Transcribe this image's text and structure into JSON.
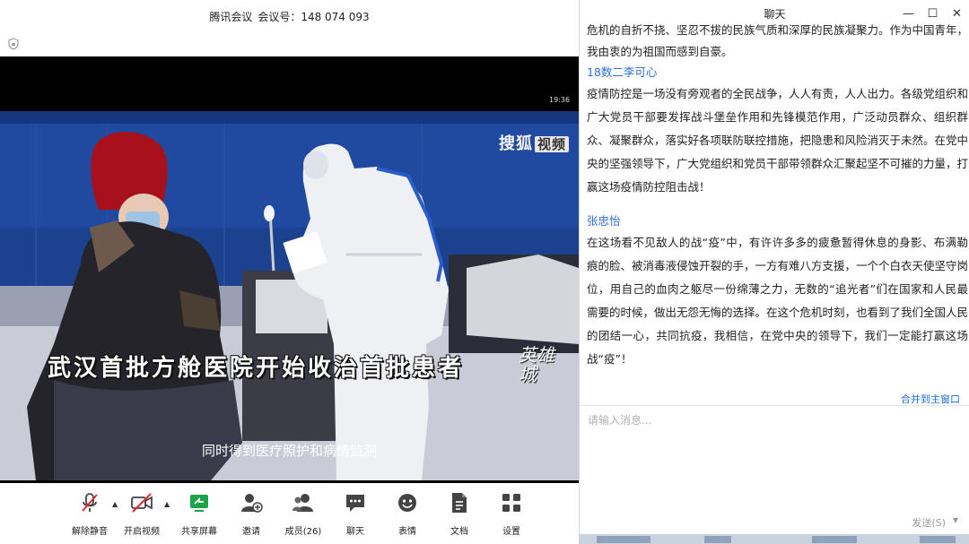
{
  "meeting": {
    "app_name": "腾讯会议",
    "meeting_id_label": "会议号：148 074 093",
    "video_time": "19:36",
    "watermark": {
      "brand": "搜狐",
      "brand_box": "视频"
    },
    "caption_main": "武汉首批方舱医院开始收治首批患者",
    "calligraphy": "英雄城",
    "subtitle": "同时得到医疗照护和病情监测"
  },
  "toolbar": {
    "mute": "解除静音",
    "video": "开启视频",
    "share": "共享屏幕",
    "invite": "邀请",
    "members": "成员(26)",
    "chat": "聊天",
    "emoji": "表情",
    "docs": "文档",
    "settings": "设置"
  },
  "chat": {
    "title": "聊天",
    "messages": {
      "cut": "危机的自折不挠、坚忍不拔的民族气质和深厚的民族凝聚力。作为中国青年，我由衷的为祖国而感到自豪。",
      "m1_sender": "18数二李可心",
      "m1_text": "疫情防控是一场没有旁观者的全民战争，人人有责，人人出力。各级党组织和广大党员干部要发挥战斗堡垒作用和先锋模范作用，广泛动员群众、组织群众、凝聚群众，落实好各项联防联控措施，把隐患和风险消灭于未然。在党中央的坚强领导下，广大党组织和党员干部带领群众汇聚起坚不可摧的力量，打赢这场疫情防控阻击战！",
      "m2_sender": "张忠怡",
      "m2_text": "在这场看不见敌人的战“疫”中，有许许多多的疲惫暂得休息的身影、布满勒痕的脸、被消毒液侵蚀开裂的手，一方有难八方支援，一个个白衣天使坚守岗位，用自己的血肉之躯尽一份绵薄之力，无数的“追光者”们在国家和人民最需要的时候，做出无怨无悔的选择。在这个危机时刻，也看到了我们全国人民的团结一心，共同抗疫，我相信，在党中央的领导下，我们一定能打赢这场战“疫”！"
    },
    "merge_link": "合并到主窗口",
    "input_placeholder": "请输入消息...",
    "send_label": "发送(S)"
  },
  "colors": {
    "link": "#2f6fd6",
    "video_bg": "#000000",
    "wall": "#1a3f8e"
  }
}
